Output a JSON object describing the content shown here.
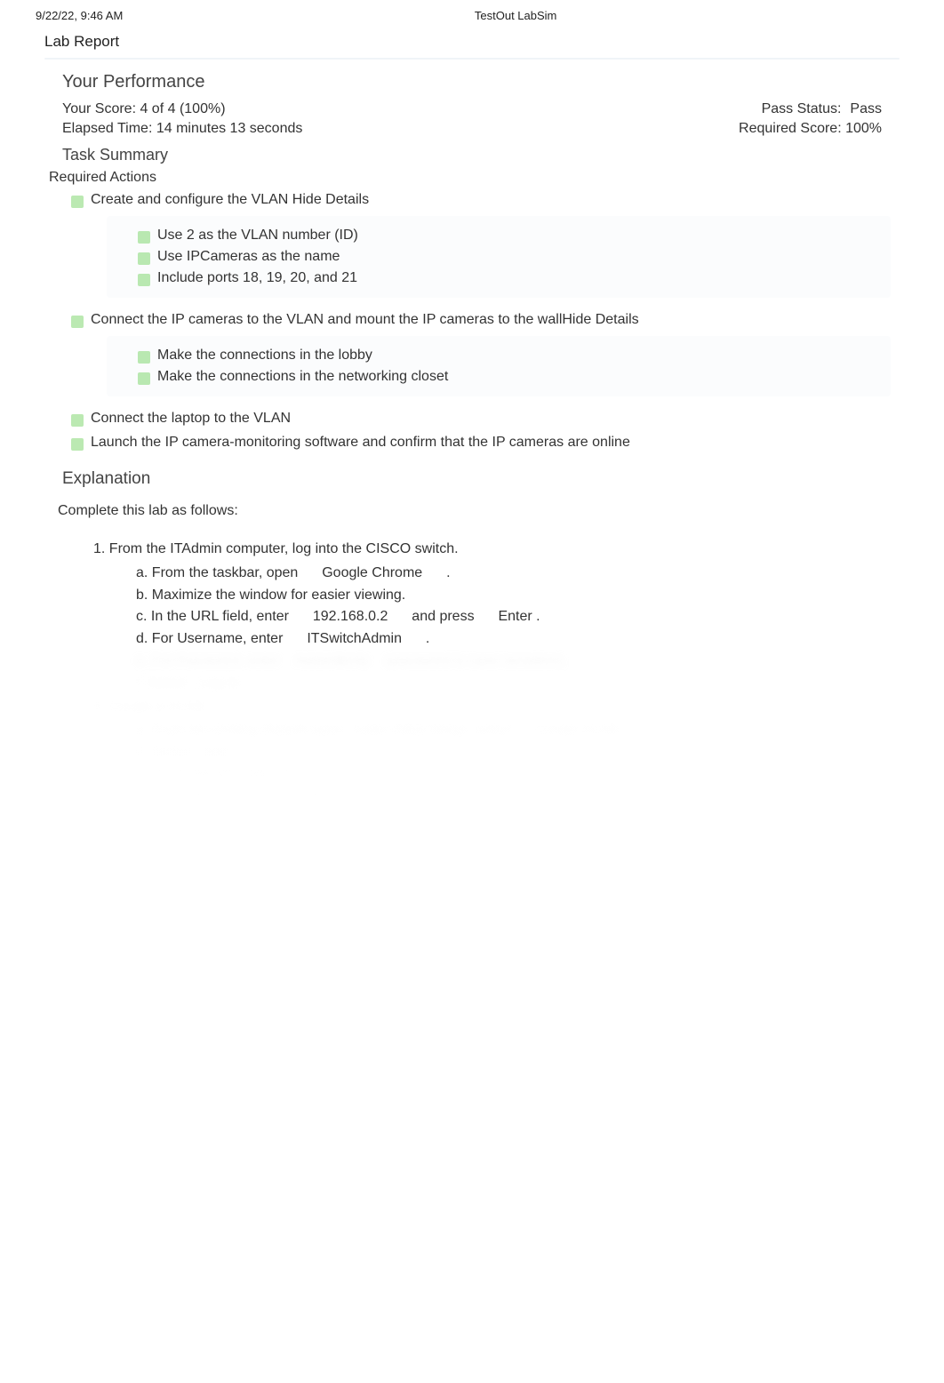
{
  "header": {
    "datetime": "9/22/22, 9:46 AM",
    "app_name": "TestOut LabSim"
  },
  "report": {
    "title": "Lab Report"
  },
  "performance": {
    "heading": "Your Performance",
    "score_label": "Your Score: 4 of 4 (100%)",
    "pass_status_label": "Pass Status:",
    "pass_status_value": "Pass",
    "elapsed_label": "Elapsed Time: 14 minutes 13 seconds",
    "required_score_label": "Required Score: 100%"
  },
  "task_summary": {
    "heading": "Task Summary",
    "required_actions_label": "Required Actions",
    "actions": [
      {
        "text": "Create and configure the VLAN Hide Details",
        "subs": [
          "Use 2 as the VLAN number (ID)",
          "Use IPCameras as the name",
          "Include ports 18, 19, 20, and 21"
        ]
      },
      {
        "text": "Connect the IP cameras to the VLAN and mount the IP cameras to the wallHide Details",
        "subs": [
          "Make the connections in the lobby",
          "Make the connections in the networking closet"
        ]
      },
      {
        "text": "Connect the laptop to the VLAN",
        "subs": []
      },
      {
        "text": "Launch the IP camera-monitoring software and confirm that the IP cameras are online",
        "subs": []
      }
    ]
  },
  "explanation": {
    "heading": "Explanation",
    "intro": "Complete this lab as follows:",
    "steps": [
      {
        "num": "1.",
        "text": "From the ITAdmin computer, log into the CISCO switch.",
        "subs": [
          {
            "letter": "a.",
            "text_a": "From the taskbar, open",
            "text_b": "Google Chrome",
            "text_c": "."
          },
          {
            "letter": "b.",
            "text_a": "Maximize the window for easier viewing.",
            "text_b": "",
            "text_c": ""
          },
          {
            "letter": "c.",
            "text_a": "In the URL field, enter",
            "text_b": "192.168.0.2",
            "text_c": "and press",
            "text_d": "Enter",
            "text_e": "."
          },
          {
            "letter": "d.",
            "text_a": "For Username, enter",
            "text_b": "ITSwitchAdmin",
            "text_c": "."
          }
        ]
      }
    ]
  }
}
